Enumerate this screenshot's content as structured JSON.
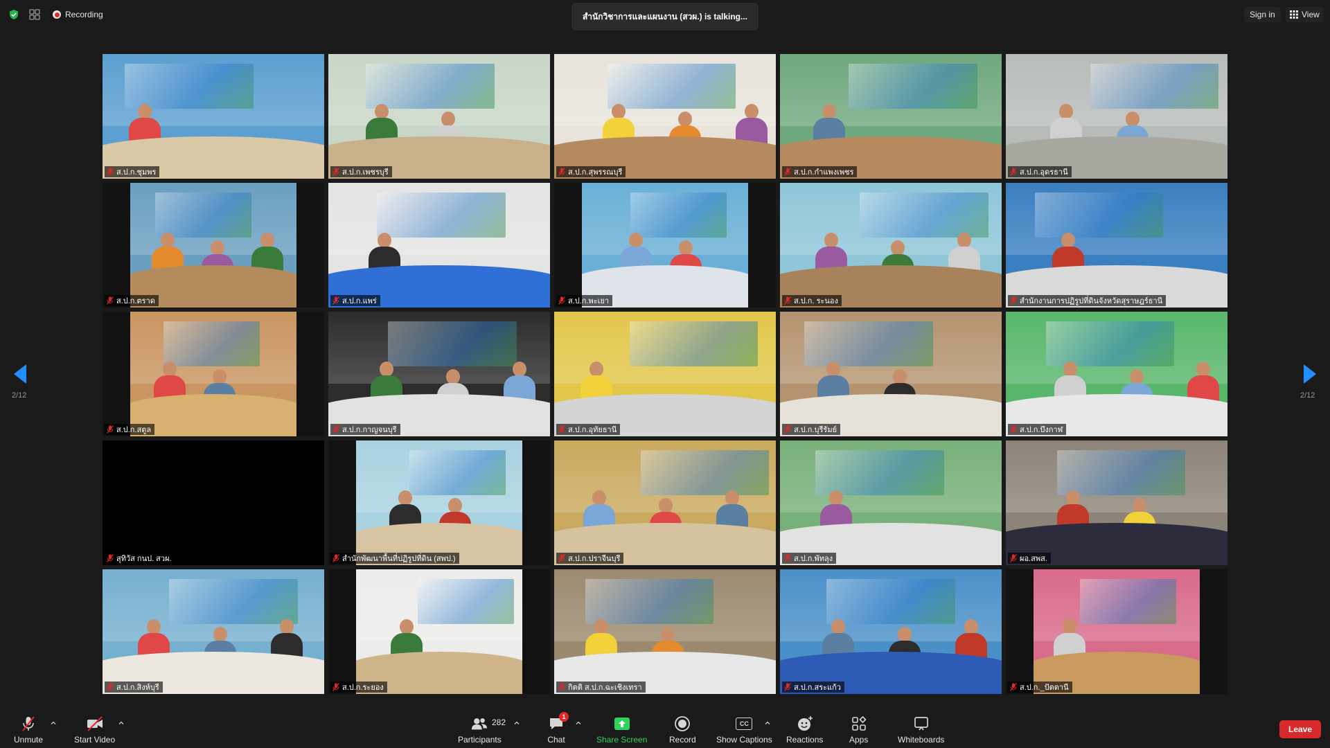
{
  "topbar": {
    "recording_label": "Recording",
    "talking_text": "สำนักวิชาการและแผนงาน (สวผ.) is talking...",
    "sign_in_label": "Sign in",
    "view_label": "View"
  },
  "pagination": {
    "left_label": "2/12",
    "right_label": "2/12"
  },
  "participants": [
    {
      "name": "ส.ป.ก.ชุมพร",
      "wall": "#5c9fd0",
      "table": "#d9c9a6"
    },
    {
      "name": "ส.ป.ก.เพชรบุรี",
      "wall": "#c8d6c8",
      "table": "#c8b08a"
    },
    {
      "name": "ส.ป.ก.สุพรรณบุรี",
      "wall": "#e8e4dc",
      "table": "#b58a5f"
    },
    {
      "name": "ส.ป.ก.กำแพงเพชร",
      "wall": "#6fa87e",
      "table": "#b88a60"
    },
    {
      "name": "ส.ป.ก.อุดรธานี",
      "wall": "#b8bcb8",
      "table": "#a8a8a0"
    },
    {
      "name": "ส.ป.ก.ตราด",
      "wall": "#6a9fc0",
      "table": "#b48b5c"
    },
    {
      "name": "ส.ป.ก.แพร่",
      "wall": "#e4e4e2",
      "table": "#2f6fd6"
    },
    {
      "name": "ส.ป.ก.พะเยา",
      "wall": "#6ab0d6",
      "table": "#dfe3ea"
    },
    {
      "name": "ส.ป.ก. ระนอง",
      "wall": "#8fc6d8",
      "table": "#a7825a"
    },
    {
      "name": "สำนักงานการปฏิรูปที่ดินจังหวัดสุราษฎร์ธานี",
      "wall": "#3a7fc0",
      "table": "#dadada"
    },
    {
      "name": "ส.ป.ก.สตูล",
      "wall": "#c99560",
      "table": "#d8b070"
    },
    {
      "name": "ส.ป.ก.กาญจนบุรี",
      "wall": "#2c2c2c",
      "table": "#e2e2e0"
    },
    {
      "name": "ส.ป.ก.อุทัยธานี",
      "wall": "#e2c64a",
      "table": "#d4d4d4"
    },
    {
      "name": "ส.ป.ก.บุรีรัมย์",
      "wall": "#b49470",
      "table": "#e6e2da"
    },
    {
      "name": "ส.ป.ก.บึงกาฬ",
      "wall": "#58b66a",
      "table": "#e8e8e8"
    },
    {
      "name": "สุทิวัส กนป. สวผ.",
      "wall": "#000000",
      "table": "#000000"
    },
    {
      "name": "สำนักพัฒนาพื้นที่ปฏิรูปที่ดิน (สพป.)",
      "wall": "#a9d2e0",
      "table": "#d6c4a2"
    },
    {
      "name": "ส.ป.ก.ปราจีนบุรี",
      "wall": "#c9a95e",
      "table": "#d6c29e"
    },
    {
      "name": "ส.ป.ก.พัทลุง",
      "wall": "#78b07a",
      "table": "#e2e2e2"
    },
    {
      "name": "ผอ.สพส.",
      "wall": "#8c8478",
      "table": "#2c2c3c"
    },
    {
      "name": "ส.ป.ก.สิงห์บุรี",
      "wall": "#76b0d0",
      "table": "#ece8e0"
    },
    {
      "name": "ส.ป.ก.ระยอง",
      "wall": "#ececea",
      "table": "#d0b48a"
    },
    {
      "name": "กิตติ ส.ป.ก.ฉะเชิงเทรา",
      "wall": "#9c8a70",
      "table": "#e8e8e8"
    },
    {
      "name": "ส.ป.ก.สระแก้ว",
      "wall": "#4a90c8",
      "table": "#2d5bb5"
    },
    {
      "name": "ส.ป.ก._ปัตตานี",
      "wall": "#d86a8a",
      "table": "#c89a60"
    }
  ],
  "toolbar": {
    "unmute_label": "Unmute",
    "start_video_label": "Start Video",
    "participants_label": "Participants",
    "participants_count": "282",
    "chat_label": "Chat",
    "chat_badge": "1",
    "share_screen_label": "Share Screen",
    "record_label": "Record",
    "show_captions_label": "Show Captions",
    "captions_icon_text": "CC",
    "reactions_label": "Reactions",
    "apps_label": "Apps",
    "whiteboards_label": "Whiteboards",
    "leave_label": "Leave"
  },
  "colors": {
    "background": "#1a1a1a",
    "share_green": "#2fd35c",
    "leave_red": "#d82a2a",
    "muted_red": "#e02828"
  }
}
